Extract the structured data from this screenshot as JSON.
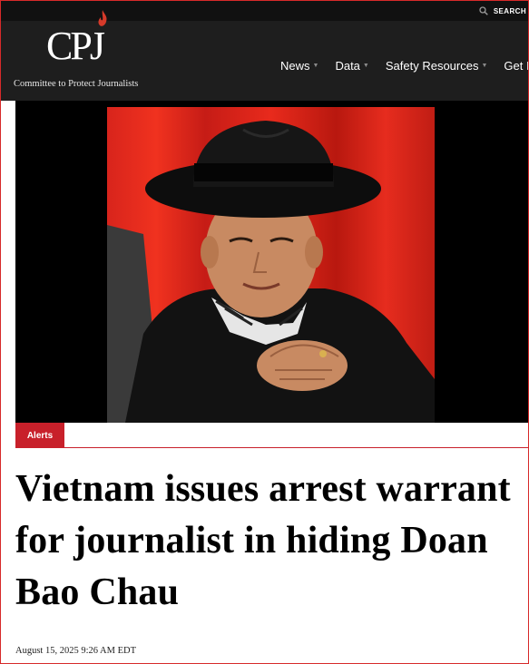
{
  "header": {
    "search_label": "SEARCH",
    "logo_text": "CPJ",
    "tagline": "Committee to Protect Journalists",
    "nav": [
      {
        "label": "News"
      },
      {
        "label": "Data"
      },
      {
        "label": "Safety Resources"
      },
      {
        "label": "Get Invo"
      }
    ]
  },
  "hero": {
    "image_icon": "portrait-photo"
  },
  "article": {
    "tag": "Alerts",
    "headline": "Vietnam issues arrest warrant for journalist in hiding Doan Bao Chau",
    "date": "August 15, 2025 9:26 AM EDT"
  },
  "colors": {
    "accent": "#c8202a",
    "header_bg": "#1e1e1e",
    "topbar_bg": "#111111"
  }
}
